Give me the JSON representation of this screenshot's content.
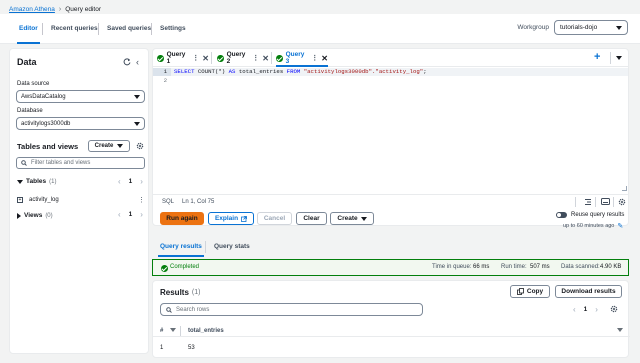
{
  "breadcrumb": {
    "parent": "Amazon Athena",
    "current": "Query editor"
  },
  "top_tabs": [
    "Editor",
    "Recent queries",
    "Saved queries",
    "Settings"
  ],
  "workgroup": {
    "label": "Workgroup",
    "value": "tutorials-dojo"
  },
  "sidebar": {
    "title": "Data",
    "data_source_label": "Data source",
    "data_source_value": "AwsDataCatalog",
    "database_label": "Database",
    "database_value": "activitylogs3000db",
    "tables_views_title": "Tables and views",
    "create_label": "Create",
    "filter_placeholder": "Filter tables and views",
    "tables_label": "Tables",
    "tables_count": "(1)",
    "tables_page": "1",
    "table_item": "activity_log",
    "views_label": "Views",
    "views_count": "(0)",
    "views_page": "1"
  },
  "query_tabs": [
    {
      "label": "Query 1",
      "active": false
    },
    {
      "label": "Query 2",
      "active": false
    },
    {
      "label": "Query 3",
      "active": true
    }
  ],
  "editor": {
    "line_numbers": [
      "1",
      "2"
    ],
    "code_select": "SELECT",
    "code_count": " COUNT(*) ",
    "code_as": "AS",
    "code_alias": " total_entries ",
    "code_from": "FROM",
    "code_table": " \"activitylogs3000db\".\"activity_log\"",
    "code_end": ";",
    "language": "SQL",
    "cursor_position": "Ln 1, Col 75"
  },
  "actions": {
    "run_again": "Run again",
    "explain": "Explain",
    "cancel": "Cancel",
    "clear": "Clear",
    "create": "Create",
    "reuse_label": "Reuse query results",
    "reuse_sub": "up to 60 minutes ago"
  },
  "results_tabs": [
    "Query results",
    "Query stats"
  ],
  "status": {
    "completed": "Completed",
    "queue_label": "Time in queue:",
    "queue_value": "66 ms",
    "run_label": "Run time:",
    "run_value": "507 ms",
    "scanned_label": "Data scanned:",
    "scanned_value": "4.90 KB"
  },
  "results": {
    "title": "Results",
    "count": "(1)",
    "copy_label": "Copy",
    "download_label": "Download results",
    "search_placeholder": "Search rows",
    "page": "1",
    "col_index": "#",
    "col_name": "total_entries",
    "row_index": "1",
    "row_value": "53"
  },
  "colors": {
    "accent": "#0972d3",
    "primary_button": "#ec7211",
    "success": "#037f0c"
  }
}
